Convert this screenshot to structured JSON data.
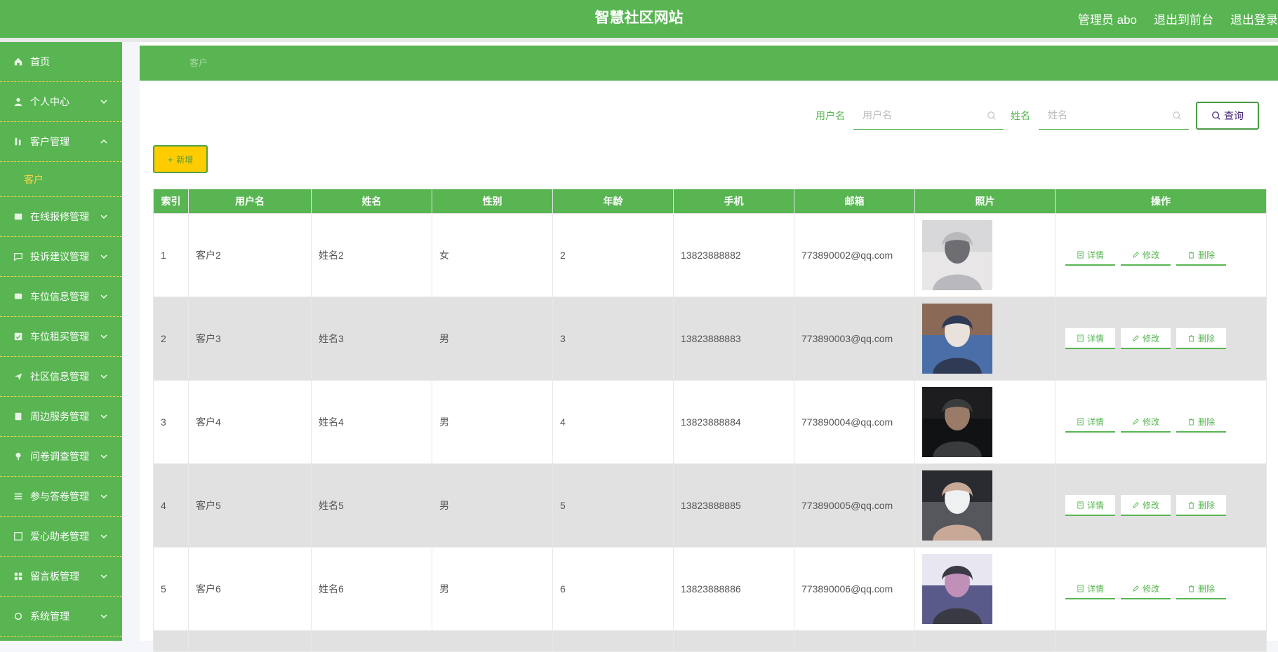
{
  "header": {
    "site_title": "智慧社区网站",
    "admin_label": "管理员 abo",
    "to_front": "退出到前台",
    "logout": "退出登录"
  },
  "sidebar": {
    "items": [
      {
        "label": "首页",
        "icon": "home-icon",
        "chevron": "none"
      },
      {
        "label": "个人中心",
        "icon": "user-icon",
        "chevron": "down"
      },
      {
        "label": "客户管理",
        "icon": "customer-icon",
        "chevron": "up",
        "sub": [
          "客户"
        ]
      },
      {
        "label": "在线报修管理",
        "icon": "repair-icon",
        "chevron": "down"
      },
      {
        "label": "投诉建议管理",
        "icon": "complaint-icon",
        "chevron": "down"
      },
      {
        "label": "车位信息管理",
        "icon": "parking-icon",
        "chevron": "down"
      },
      {
        "label": "车位租买管理",
        "icon": "parking-rent-icon",
        "chevron": "down"
      },
      {
        "label": "社区信息管理",
        "icon": "community-icon",
        "chevron": "down"
      },
      {
        "label": "周边服务管理",
        "icon": "service-icon",
        "chevron": "down"
      },
      {
        "label": "问卷调查管理",
        "icon": "survey-icon",
        "chevron": "down"
      },
      {
        "label": "参与答卷管理",
        "icon": "answer-icon",
        "chevron": "down"
      },
      {
        "label": "爱心助老管理",
        "icon": "elderly-icon",
        "chevron": "down"
      },
      {
        "label": "留言板管理",
        "icon": "message-board-icon",
        "chevron": "down"
      },
      {
        "label": "系统管理",
        "icon": "system-icon",
        "chevron": "down"
      }
    ]
  },
  "breadcrumb": "客户",
  "search": {
    "username_label": "用户名",
    "username_placeholder": "用户名",
    "username_value": "",
    "name_label": "姓名",
    "name_placeholder": "姓名",
    "name_value": "",
    "query_label": "查询"
  },
  "add_button": "新增",
  "table": {
    "columns": [
      "索引",
      "用户名",
      "姓名",
      "性别",
      "年龄",
      "手机",
      "邮箱",
      "照片",
      "操作"
    ],
    "rows": [
      {
        "index": "1",
        "username": "客户2",
        "name": "姓名2",
        "gender": "女",
        "age": "2",
        "phone": "13823888882",
        "email": "773890002@qq.com",
        "photo_palette": [
          "#d8d8da",
          "#b9b9bd",
          "#6e6e72",
          "#e8e6e6"
        ]
      },
      {
        "index": "2",
        "username": "客户3",
        "name": "姓名3",
        "gender": "男",
        "age": "3",
        "phone": "13823888883",
        "email": "773890003@qq.com",
        "photo_palette": [
          "#8a6a56",
          "#2f3a55",
          "#e9e1dc",
          "#4a6fa8"
        ]
      },
      {
        "index": "3",
        "username": "客户4",
        "name": "姓名4",
        "gender": "男",
        "age": "4",
        "phone": "13823888884",
        "email": "773890004@qq.com",
        "photo_palette": [
          "#1d1d1f",
          "#3a3b3d",
          "#9a7b68",
          "#111214"
        ]
      },
      {
        "index": "4",
        "username": "客户5",
        "name": "姓名5",
        "gender": "男",
        "age": "5",
        "phone": "13823888885",
        "email": "773890005@qq.com",
        "photo_palette": [
          "#2a2b30",
          "#c8a896",
          "#eef0f2",
          "#55575c"
        ]
      },
      {
        "index": "5",
        "username": "客户6",
        "name": "姓名6",
        "gender": "男",
        "age": "6",
        "phone": "13823888886",
        "email": "773890006@qq.com",
        "photo_palette": [
          "#e8e6f0",
          "#3a3a44",
          "#c090b8",
          "#5a5a8a"
        ]
      }
    ],
    "actions": {
      "detail": "详情",
      "edit": "修改",
      "delete": "删除"
    }
  },
  "colors": {
    "primary_green": "#58b552",
    "accent_yellow": "#ffcc00",
    "submenu_yellow": "#f6d54b",
    "alt_row": "#e2e1e1"
  }
}
